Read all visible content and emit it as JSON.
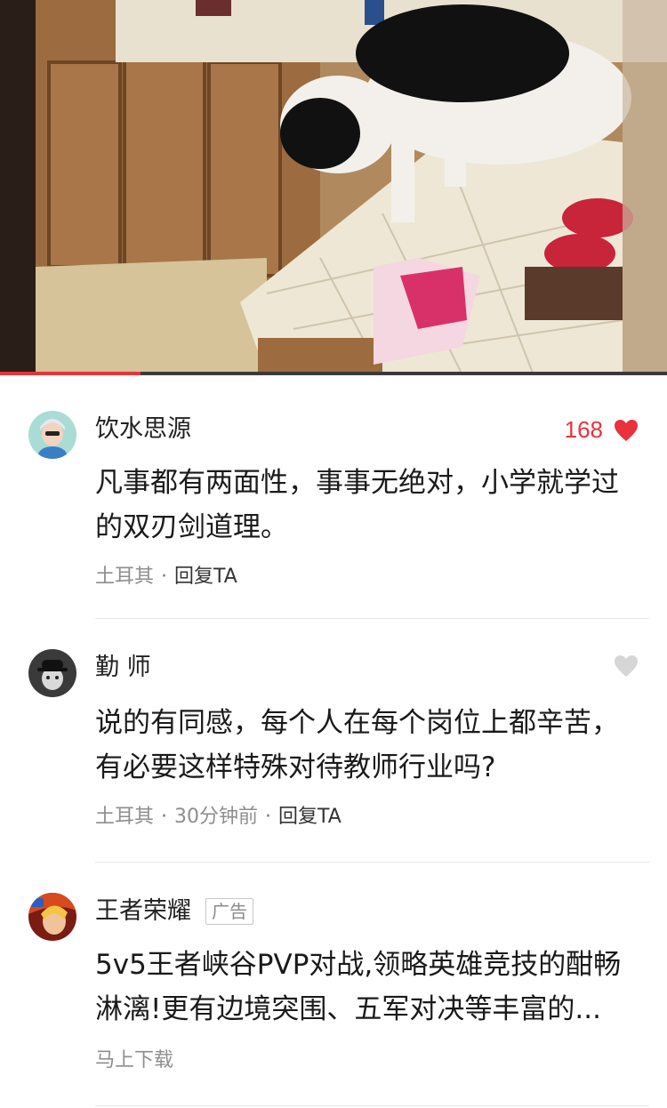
{
  "video": {
    "progress": 0.21,
    "colors": {
      "progress_fill": "#e8333c",
      "progress_track": "#3a3a3a"
    }
  },
  "comments": [
    {
      "username": "饮水思源",
      "like_count": "168",
      "liked": true,
      "text": "凡事都有两面性，事事无绝对，小学就学过的双刃剑道理。",
      "location": "土耳其",
      "reply_label": "回复TA"
    },
    {
      "username": "勤 师",
      "liked": false,
      "text": "说的有同感，每个人在每个岗位上都辛苦，有必要这样特殊对待教师行业吗?",
      "location": "土耳其",
      "time": "30分钟前",
      "reply_label": "回复TA"
    },
    {
      "username": "王者荣耀",
      "badge": "广告",
      "text": "5v5王者峡谷PVP对战,领略英雄竞技的酣畅淋漓!更有边境突围、五军对决等丰富的...",
      "action_label": "马上下载"
    }
  ],
  "icons": {
    "like_active": "heart-filled-icon",
    "like_inactive": "heart-outline-icon"
  },
  "colors": {
    "accent": "#e8333c",
    "meta_text": "#8e8e8e",
    "divider": "#e6e6e6"
  }
}
